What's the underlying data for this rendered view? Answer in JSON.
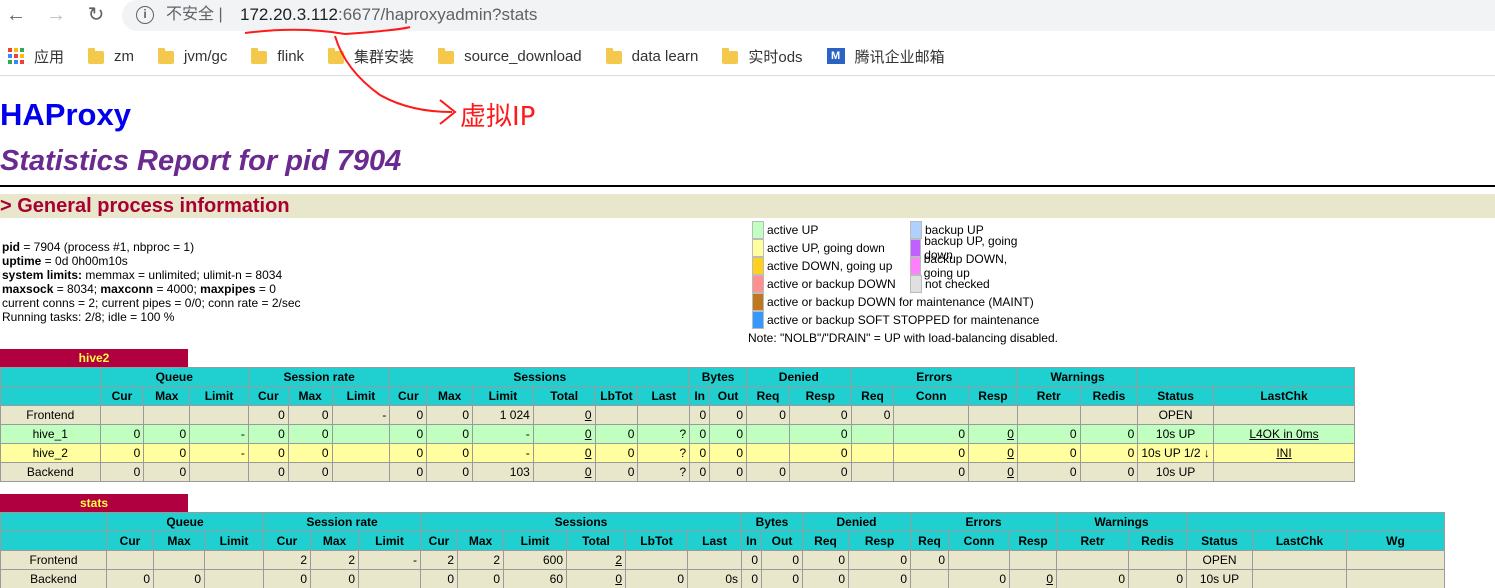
{
  "browser": {
    "insecure_label": "不安全",
    "url_host": "172.20.3.112",
    "url_rest": ":6677/haproxyadmin?stats",
    "bookmarks": [
      {
        "label": "应用",
        "icon": "apps-icon"
      },
      {
        "label": "zm",
        "icon": "folder-icon"
      },
      {
        "label": "jvm/gc",
        "icon": "folder-icon"
      },
      {
        "label": "flink",
        "icon": "folder-icon"
      },
      {
        "label": "集群安装",
        "icon": "folder-icon"
      },
      {
        "label": "source_download",
        "icon": "folder-icon"
      },
      {
        "label": "data learn",
        "icon": "folder-icon"
      },
      {
        "label": "实时ods",
        "icon": "folder-icon"
      },
      {
        "label": "腾讯企业邮箱",
        "icon": "tencent-mail-icon"
      }
    ]
  },
  "annotation": {
    "text": "虚拟IP",
    "color": "#ff1a1a"
  },
  "header": {
    "title": "HAProxy",
    "subtitle": "Statistics Report for pid 7904",
    "section": "> General process information"
  },
  "process": {
    "pid_label": "pid",
    "pid_text": " = 7904 (process #1, nbproc = 1)",
    "uptime_label": "uptime",
    "uptime_text": " = 0d 0h00m10s",
    "limits_label": "system limits:",
    "limits_text": " memmax = unlimited; ulimit-n = 8034",
    "maxsock_label": "maxsock",
    "maxsock_text": " = 8034; ",
    "maxconn_label": "maxconn",
    "maxconn_text": " = 4000; ",
    "maxpipes_label": "maxpipes",
    "maxpipes_text": " = 0",
    "conns_text": "current conns = 2; current pipes = 0/0; conn rate = 2/sec",
    "tasks_text": "Running tasks: 2/8; idle = 100 %"
  },
  "legend": {
    "col1": [
      {
        "label": "active UP",
        "color": "#c0ffc0"
      },
      {
        "label": "active UP, going down",
        "color": "#ffffa0"
      },
      {
        "label": "active DOWN, going up",
        "color": "#ffd020"
      },
      {
        "label": "active or backup DOWN",
        "color": "#ff9090"
      },
      {
        "label": "active or backup DOWN for maintenance (MAINT)",
        "color": "#c07820"
      },
      {
        "label": "active or backup SOFT STOPPED for maintenance",
        "color": "#3399ff"
      }
    ],
    "col2": [
      {
        "label": "backup UP",
        "color": "#b0d0ff"
      },
      {
        "label": "backup UP, going down",
        "color": "#c060ff"
      },
      {
        "label": "backup DOWN, going up",
        "color": "#ff80ff"
      },
      {
        "label": "not checked",
        "color": "#e0e0e0"
      }
    ],
    "note": "Note: \"NOLB\"/\"DRAIN\" = UP with load-balancing disabled."
  },
  "groups": [
    "Queue",
    "Session rate",
    "Sessions",
    "Bytes",
    "Denied",
    "Errors",
    "Warnings"
  ],
  "columns": [
    "Cur",
    "Max",
    "Limit",
    "Cur",
    "Max",
    "Limit",
    "Cur",
    "Max",
    "Limit",
    "Total",
    "LbTot",
    "Last",
    "In",
    "Out",
    "Req",
    "Resp",
    "Req",
    "Conn",
    "Resp",
    "Retr",
    "Redis",
    "Status",
    "LastChk"
  ],
  "proxies": [
    {
      "name": "hive2",
      "rows": [
        {
          "name": "Frontend",
          "cells": [
            "",
            "",
            "",
            "0",
            "0",
            "-",
            "0",
            "0",
            "1 024",
            "0",
            "",
            "",
            "0",
            "0",
            "0",
            "0",
            "0",
            "",
            "",
            "",
            "",
            "OPEN",
            ""
          ]
        },
        {
          "name": "hive_1",
          "cells": [
            "0",
            "0",
            "-",
            "0",
            "0",
            "",
            "0",
            "0",
            "-",
            "0",
            "0",
            "?",
            "0",
            "0",
            "",
            "0",
            "",
            "0",
            "0",
            "0",
            "0",
            "10s UP",
            "L4OK in 0ms"
          ]
        },
        {
          "name": "hive_2",
          "cells": [
            "0",
            "0",
            "-",
            "0",
            "0",
            "",
            "0",
            "0",
            "-",
            "0",
            "0",
            "?",
            "0",
            "0",
            "",
            "0",
            "",
            "0",
            "0",
            "0",
            "0",
            "10s UP 1/2 ↓",
            "INI"
          ]
        },
        {
          "name": "Backend",
          "cells": [
            "0",
            "0",
            "",
            "0",
            "0",
            "",
            "0",
            "0",
            "103",
            "0",
            "0",
            "?",
            "0",
            "0",
            "0",
            "0",
            "",
            "0",
            "0",
            "0",
            "0",
            "10s UP",
            ""
          ]
        }
      ]
    },
    {
      "name": "stats",
      "extra_col": "Wg",
      "rows": [
        {
          "name": "Frontend",
          "cells": [
            "",
            "",
            "",
            "2",
            "2",
            "-",
            "2",
            "2",
            "600",
            "2",
            "",
            "",
            "0",
            "0",
            "0",
            "0",
            "0",
            "",
            "",
            "",
            "",
            "OPEN",
            ""
          ]
        },
        {
          "name": "Backend",
          "cells": [
            "0",
            "0",
            "",
            "0",
            "0",
            "",
            "0",
            "0",
            "60",
            "0",
            "0",
            "0s",
            "0",
            "0",
            "0",
            "0",
            "",
            "0",
            "0",
            "0",
            "0",
            "10s UP",
            ""
          ]
        }
      ]
    }
  ]
}
